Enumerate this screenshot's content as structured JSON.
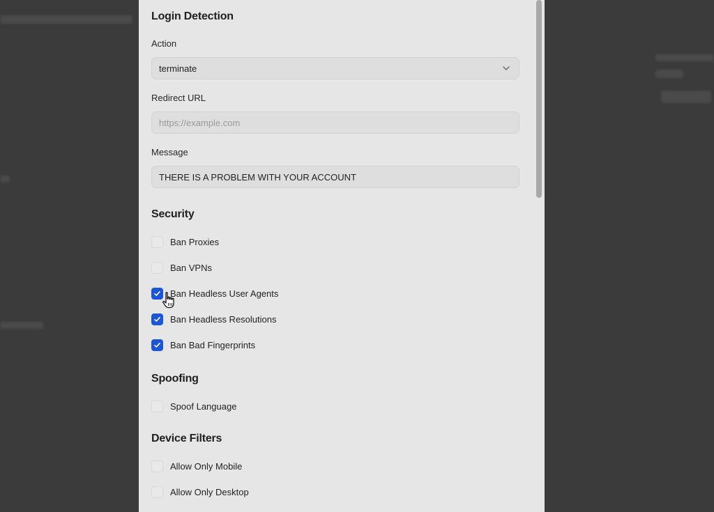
{
  "login_detection": {
    "title": "Login Detection",
    "action": {
      "label": "Action",
      "value": "terminate"
    },
    "redirect_url": {
      "label": "Redirect URL",
      "placeholder": "https://example.com",
      "value": ""
    },
    "message": {
      "label": "Message",
      "value": "THERE IS A PROBLEM WITH YOUR ACCOUNT"
    }
  },
  "security": {
    "title": "Security",
    "items": [
      {
        "label": "Ban Proxies",
        "checked": false
      },
      {
        "label": "Ban VPNs",
        "checked": false
      },
      {
        "label": "Ban Headless User Agents",
        "checked": true
      },
      {
        "label": "Ban Headless Resolutions",
        "checked": true
      },
      {
        "label": "Ban Bad Fingerprints",
        "checked": true
      }
    ]
  },
  "spoofing": {
    "title": "Spoofing",
    "items": [
      {
        "label": "Spoof Language",
        "checked": false
      }
    ]
  },
  "device_filters": {
    "title": "Device Filters",
    "items": [
      {
        "label": "Allow Only Mobile",
        "checked": false
      },
      {
        "label": "Allow Only Desktop",
        "checked": false
      }
    ]
  },
  "colors": {
    "accent": "#1a56d6",
    "panel": "#e6e6e6",
    "backdrop": "#3b3b3b"
  }
}
